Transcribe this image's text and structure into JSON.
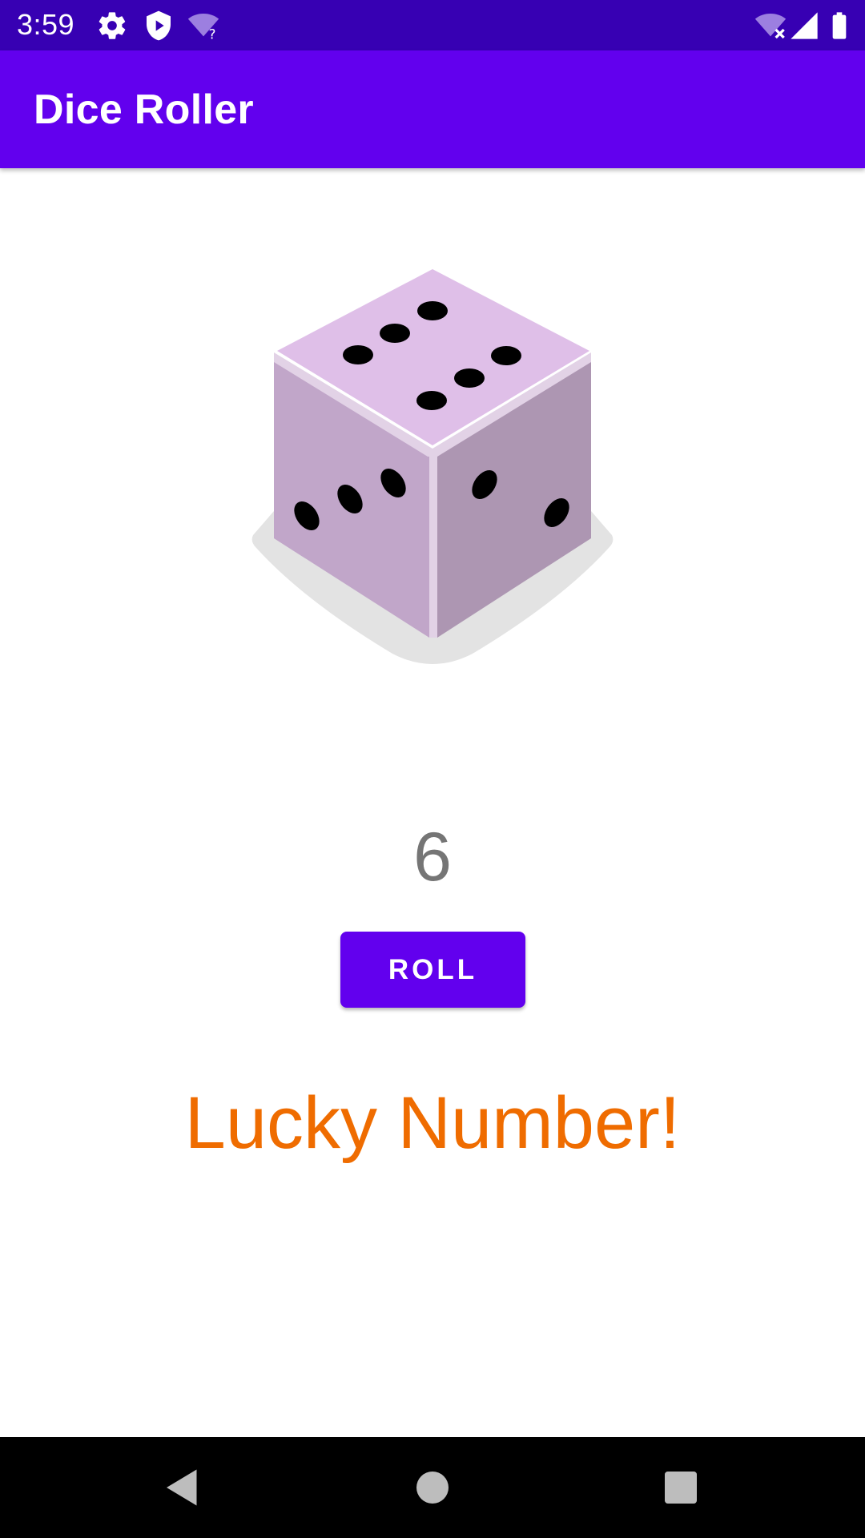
{
  "status_bar": {
    "time": "3:59",
    "icons": [
      "settings-icon",
      "shield-play-icon",
      "wifi-question-icon",
      "wifi-off-icon",
      "cellular-signal-icon",
      "battery-icon"
    ],
    "background": "#3700b3"
  },
  "app_bar": {
    "title": "Dice Roller",
    "background": "#6200ee"
  },
  "dice": {
    "top_face_value": 6,
    "icon": "dice-icon"
  },
  "result": {
    "value": "6",
    "color": "#757575"
  },
  "roll_button": {
    "label": "ROLL",
    "color": "#6200ee"
  },
  "lucky_message": {
    "text": "Lucky Number!",
    "color": "#ef6c00"
  },
  "navigation_bar": {
    "buttons": [
      "back-icon",
      "home-icon",
      "recents-icon"
    ]
  }
}
